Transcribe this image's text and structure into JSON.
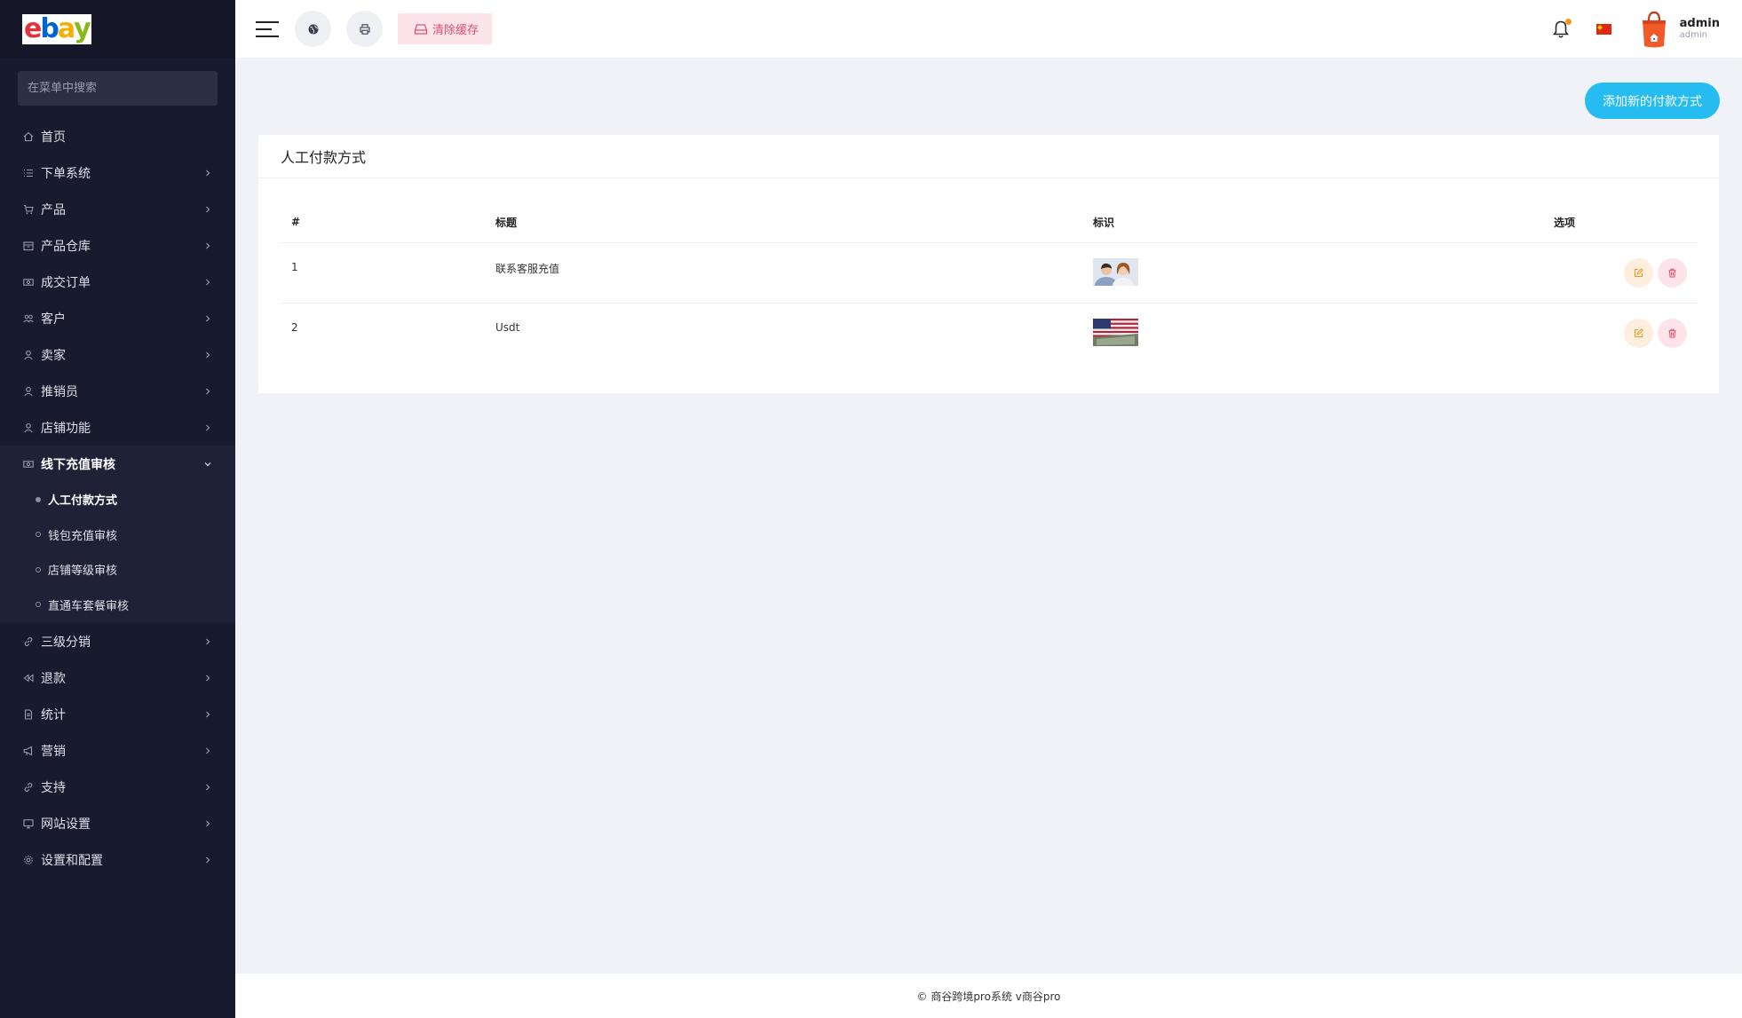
{
  "brand": {
    "logo_letters": [
      "e",
      "b",
      "a",
      "y"
    ],
    "logo_colors": [
      "#e53238",
      "#0064d2",
      "#f5af02",
      "#86b817"
    ]
  },
  "sidebar": {
    "search_placeholder": "在菜单中搜索",
    "items": [
      {
        "label": "首页",
        "icon": "home-icon"
      },
      {
        "label": "下单系统",
        "icon": "list-icon"
      },
      {
        "label": "产品",
        "icon": "cart-icon"
      },
      {
        "label": "产品仓库",
        "icon": "archive-icon"
      },
      {
        "label": "成交订单",
        "icon": "money-icon"
      },
      {
        "label": "客户",
        "icon": "users-icon"
      },
      {
        "label": "卖家",
        "icon": "user-icon"
      },
      {
        "label": "推销员",
        "icon": "user-tie-icon"
      },
      {
        "label": "店铺功能",
        "icon": "user-icon"
      },
      {
        "label": "线下充值审核",
        "icon": "money-icon",
        "open": true
      },
      {
        "label": "三级分销",
        "icon": "link-icon"
      },
      {
        "label": "退款",
        "icon": "backward-icon"
      },
      {
        "label": "统计",
        "icon": "file-icon"
      },
      {
        "label": "营销",
        "icon": "bullhorn-icon"
      },
      {
        "label": "支持",
        "icon": "link-icon"
      },
      {
        "label": "网站设置",
        "icon": "desktop-icon"
      },
      {
        "label": "设置和配置",
        "icon": "gear-icon"
      }
    ],
    "subitems": [
      {
        "label": "人工付款方式",
        "active": true
      },
      {
        "label": "钱包充值审核"
      },
      {
        "label": "店铺等级审核"
      },
      {
        "label": "直通车套餐审核"
      }
    ]
  },
  "topbar": {
    "clear_cache_label": "清除缓存",
    "user_name": "admin",
    "user_role": "admin"
  },
  "main": {
    "add_button_label": "添加新的付款方式",
    "card_title": "人工付款方式",
    "columns": [
      "#",
      "标题",
      "标识",
      "选项"
    ],
    "rows": [
      {
        "num": "1",
        "title": "联系客服充值",
        "image": "people-photo"
      },
      {
        "num": "2",
        "title": "Usdt",
        "image": "usd-flag-photo"
      }
    ]
  },
  "footer": {
    "text": "© 商谷跨境pro系统 v商谷pro"
  },
  "colors": {
    "sidebar_bg": "#181a2e",
    "accent": "#25bcf1",
    "danger": "#e0506f",
    "warning": "#f7941d"
  }
}
